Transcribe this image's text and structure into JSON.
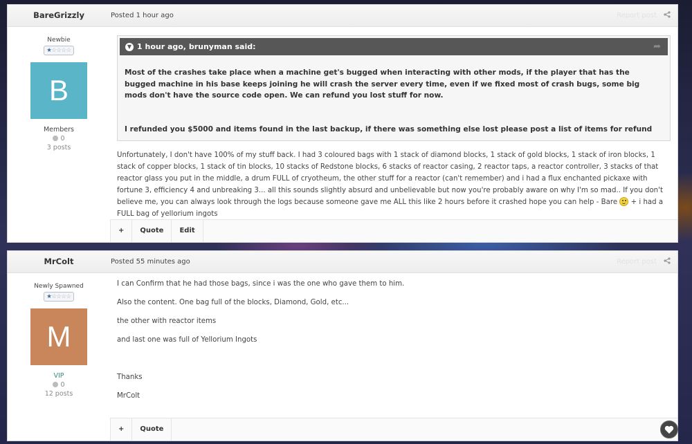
{
  "posts": [
    {
      "author": "BareGrizzly",
      "posted": "Posted 1 hour ago",
      "report": "Report post",
      "rank_title": "Newbie",
      "stars_filled": 1,
      "stars_total": 5,
      "avatar_letter": "B",
      "avatar_color": "#5ab5c8",
      "group": "Members",
      "reputation": "0",
      "post_count": "3 posts",
      "quote": {
        "header": "1 hour ago, brunyman said:",
        "paragraph1": "Most of the crashes take place when a machine get's bugged when interacting with other mods, if the player that has the bugged machine in his base keeps joining he will crash the server every time, even if we fixed most of crash bugs, some big mods don't have the source code open. We can refund you lost stuff for now.",
        "paragraph2": "I refunded you $5000 and items found in the last backup, if there was something else lost please post a list of items for refund"
      },
      "body_before_smiley": "Unfortunately, I don't have 100% of my stuff back. I had 3 coloured bags with 1 stack of diamond blocks, 1 stack of gold blocks, 1 stack of iron blocks, 1 stack of copper blocks, 1 stack of tin blocks, 10 stacks of Redstone blocks, 6 stacks of reactor casing, 2 reactor taps, a reactor controller, 3 stacks of that reactor glass you put in the middle, a drum FULL of cryotheum, the other stuff for a reactor (can't remember) and i had a flux enchanted pickaxe with fortune 3, efficiency 4 and unbreaking 3... all this sounds slightly absurd and unbelievable but now you're probably aware on why I'm so mad.. If you don't believe me, you can always look through the logs because someone gave me ALL this like 2 hours before it crashed hope you can help - Bare",
      "body_after_smiley": " + i had a FULL bag of yellorium ingots",
      "buttons": [
        "+",
        "Quote",
        "Edit"
      ]
    },
    {
      "author": "MrColt",
      "posted": "Posted 55 minutes ago",
      "report": "Report post",
      "rank_title": "Newly Spawned",
      "stars_filled": 1,
      "stars_total": 5,
      "avatar_letter": "M",
      "avatar_color": "#c8865a",
      "group": "VIP",
      "group_color": "#3a8a8a",
      "reputation": "0",
      "post_count": "12 posts",
      "lines": [
        "I can Confirm that he had those bags, since i was the one who gave them to him.",
        "Also the content. One bag full of the blocks, Diamond, Gold, etc...",
        "the other with reactor items",
        "and last one was full of Yellorium Ingots",
        "",
        "Thanks",
        "MrColt"
      ],
      "buttons": [
        "+",
        "Quote"
      ]
    }
  ]
}
